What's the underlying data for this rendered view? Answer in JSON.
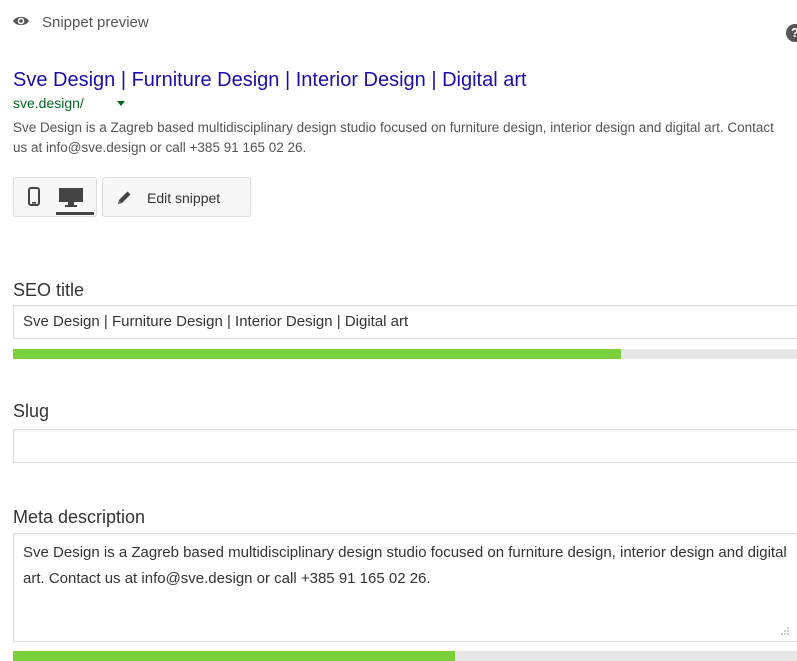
{
  "header": {
    "preview_label": "Snippet preview",
    "help_symbol": "?"
  },
  "snippet": {
    "title": "Sve Design | Furniture Design | Interior Design | Digital art",
    "url": "sve.design/",
    "description": "Sve Design is a Zagreb based multidisciplinary design studio focused on furniture design, interior design and digital art. Contact us at info@sve.design or call +385 91 165 02 26."
  },
  "toolbar": {
    "edit_label": "Edit snippet",
    "active_device": "desktop"
  },
  "fields": {
    "seo_title": {
      "label": "SEO title",
      "value": "Sve Design | Furniture Design | Interior Design | Digital art",
      "progress": 0.77
    },
    "slug": {
      "label": "Slug",
      "value": ""
    },
    "meta_description": {
      "label": "Meta description",
      "value": "Sve Design is a Zagreb based multidisciplinary design studio focused on furniture design, interior design and digital art. Contact us at info@sve.design or call +385 91 165 02 26.",
      "progress": 0.56
    }
  },
  "colors": {
    "link_title": "#1a0dab",
    "url_green": "#006621",
    "progress_good": "#7ad03a",
    "progress_track": "#e6e6e6"
  },
  "icons": [
    "eye-icon",
    "help-icon",
    "mobile-icon",
    "desktop-icon",
    "pencil-icon",
    "chevron-down-icon"
  ]
}
